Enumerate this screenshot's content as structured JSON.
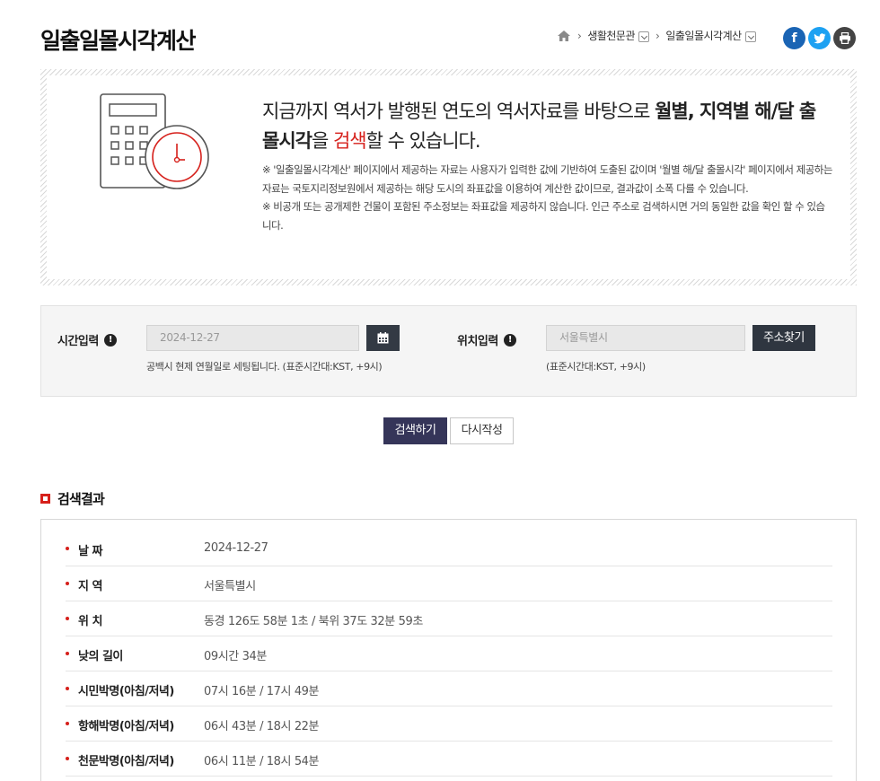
{
  "header": {
    "title": "일출일몰시각계산",
    "breadcrumb": {
      "section": "생활천문관",
      "current": "일출일몰시각계산"
    }
  },
  "icons": {
    "home": "home-icon",
    "facebook": "facebook-icon",
    "twitter": "twitter-icon",
    "print": "print-icon",
    "calendar": "calendar-icon",
    "info": "info-icon"
  },
  "colors": {
    "accent_red": "#d6201b",
    "search_button": "#353559",
    "dark_button": "#2f3640",
    "facebook": "#1a64b4",
    "twitter": "#1da1f2"
  },
  "intro": {
    "lead_1": "지금까지 역서가 발행된 연도의 역서자료를 바탕으로 ",
    "lead_bold_1": "월별, 지역별 해/달 출몰시각",
    "lead_2": "을 ",
    "lead_red": "검색",
    "lead_3": "할 수 있습니다.",
    "note_1": "※ '일출일몰시각계산' 페이지에서 제공하는 자료는 사용자가 입력한 값에 기반하여 도출된 값이며 '월별 해/달 출몰시각' 페이지에서 제공하는 자료는 국토지리정보원에서 제공하는 해당 도시의 좌표값을 이용하여 계산한 값이므로, 결과값이 소폭 다를 수 있습니다.",
    "note_2": "※ 비공개 또는 공개제한 건물이 포함된 주소정보는 좌표값을 제공하지 않습니다. 인근 주소로 검색하시면 거의 동일한 값을 확인 할 수 있습니다."
  },
  "search": {
    "time_label": "시간입력",
    "time_value": "2024-12-27",
    "time_hint": "공백시 현제 연월일로 세팅됩니다. (표준시간대:KST, +9시)",
    "location_label": "위치입력",
    "location_value": "서울특별시",
    "location_hint": "(표준시간대:KST, +9시)",
    "address_button": "주소찾기",
    "search_button": "검색하기",
    "reset_button": "다시작성"
  },
  "result": {
    "title": "검색결과",
    "rows": [
      {
        "label": "날 짜",
        "value": "2024-12-27"
      },
      {
        "label": "지 역",
        "value": "서울특별시"
      },
      {
        "label": "위 치",
        "value": "동경 126도 58분 1초 / 북위 37도 32분 59초"
      },
      {
        "label": "낮의 길이",
        "value": "09시간 34분"
      },
      {
        "label": "시민박명(아침/저녁)",
        "value": "07시 16분 / 17시 49분"
      },
      {
        "label": "항해박명(아침/저녁)",
        "value": "06시 43분 / 18시 22분"
      },
      {
        "label": "천문박명(아침/저녁)",
        "value": "06시 11분 / 18시 54분"
      }
    ]
  }
}
